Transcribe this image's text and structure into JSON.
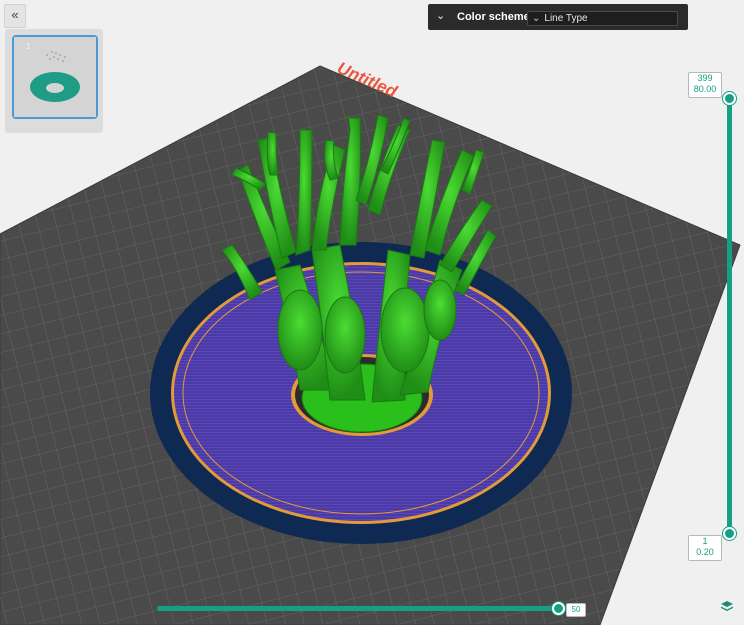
{
  "toolbar": {
    "expand_icon": "double-chevron-icon"
  },
  "plates": {
    "items": [
      {
        "number": "1",
        "selected": true
      }
    ]
  },
  "plate_label": "Untitled",
  "color_scheme": {
    "label": "Color scheme",
    "selected": "Line Type",
    "collapse_icon": "double-chevron-down-icon",
    "dropdown_icon": "chevron-down-icon"
  },
  "layer_slider": {
    "top_layer": "399",
    "top_height": "80.00",
    "bottom_layer": "1",
    "bottom_height": "0.20"
  },
  "move_slider": {
    "value": "50"
  },
  "colors": {
    "accent": "#15a085",
    "plate_label": "#e8573c",
    "support": "#3cc428",
    "infill_purple": "#4b3aa6",
    "brim_dark": "#0f2a52",
    "perimeter_orange": "#e29a3a"
  }
}
